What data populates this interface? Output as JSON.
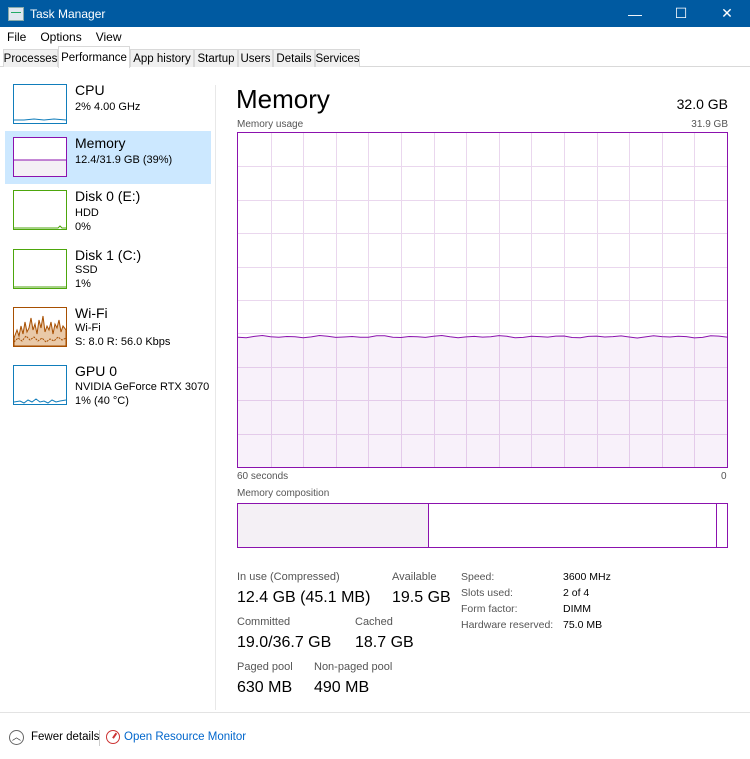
{
  "window": {
    "title": "Task Manager",
    "controls": {
      "minimize": "—",
      "maximize": "☐",
      "close": "✕"
    }
  },
  "menu": [
    "File",
    "Options",
    "View"
  ],
  "tabs": [
    "Processes",
    "Performance",
    "App history",
    "Startup",
    "Users",
    "Details",
    "Services"
  ],
  "active_tab": "Performance",
  "sidebar": [
    {
      "name": "CPU",
      "line1": "2% 4.00 GHz",
      "line2": "",
      "color": "#117dbb"
    },
    {
      "name": "Memory",
      "line1": "12.4/31.9 GB (39%)",
      "line2": "",
      "color": "#8b12ae"
    },
    {
      "name": "Disk 0 (E:)",
      "line1": "HDD",
      "line2": "0%",
      "color": "#4da60c"
    },
    {
      "name": "Disk 1 (C:)",
      "line1": "SSD",
      "line2": "1%",
      "color": "#4da60c"
    },
    {
      "name": "Wi-Fi",
      "line1": "Wi-Fi",
      "line2": "S: 8.0  R: 56.0 Kbps",
      "color": "#a74f01"
    },
    {
      "name": "GPU 0",
      "line1": "NVIDIA GeForce RTX 3070",
      "line2": "1% (40 °C)",
      "color": "#117dbb"
    }
  ],
  "main": {
    "title": "Memory",
    "total": "32.0 GB",
    "usage_label": "Memory usage",
    "usage_max": "31.9 GB",
    "usage_fraction": 0.39,
    "x_left": "60 seconds",
    "x_right": "0",
    "composition_label": "Memory composition",
    "composition": {
      "in_use_fraction": 0.39,
      "modified_fraction": 0.005,
      "free_fraction": 0.02
    },
    "stats": {
      "in_use_label": "In use (Compressed)",
      "in_use_value": "12.4 GB (45.1 MB)",
      "available_label": "Available",
      "available_value": "19.5 GB",
      "committed_label": "Committed",
      "committed_value": "19.0/36.7 GB",
      "cached_label": "Cached",
      "cached_value": "18.7 GB",
      "paged_label": "Paged pool",
      "paged_value": "630 MB",
      "nonpaged_label": "Non-paged pool",
      "nonpaged_value": "490 MB"
    },
    "specs": [
      {
        "label": "Speed:",
        "value": "3600 MHz"
      },
      {
        "label": "Slots used:",
        "value": "2 of 4"
      },
      {
        "label": "Form factor:",
        "value": "DIMM"
      },
      {
        "label": "Hardware reserved:",
        "value": "75.0 MB"
      }
    ],
    "accent": "#8b12ae"
  },
  "footer": {
    "fewer_details": "Fewer details",
    "open_resource_monitor": "Open Resource Monitor"
  }
}
